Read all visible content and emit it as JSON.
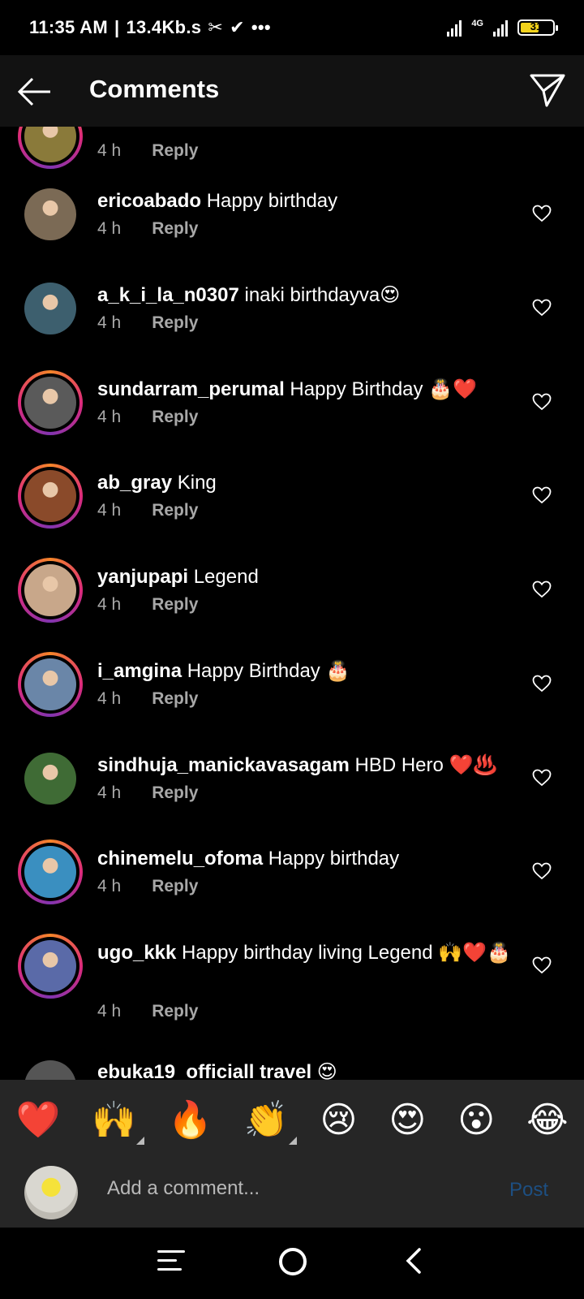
{
  "status_bar": {
    "time": "11:35 AM",
    "speed": "13.4Kb.s",
    "network": "4G",
    "battery": "31"
  },
  "header": {
    "title": "Comments"
  },
  "comments": [
    {
      "user": "",
      "text": "",
      "time": "4 h",
      "reply": "Reply",
      "ring": true,
      "avatar_color": "#8a7a3a"
    },
    {
      "user": "ericoabado",
      "text": " Happy birthday",
      "time": "4 h",
      "reply": "Reply",
      "ring": false,
      "avatar_color": "#7b6a55"
    },
    {
      "user": "a_k_i_la_n0307",
      "text": " inaki birthdayva😍",
      "time": "4 h",
      "reply": "Reply",
      "ring": false,
      "avatar_color": "#3d5f6e"
    },
    {
      "user": "sundarram_perumal",
      "text": " Happy Birthday 🎂❤️",
      "time": "4 h",
      "reply": "Reply",
      "ring": true,
      "avatar_color": "#5a5a5a"
    },
    {
      "user": "ab_gray",
      "text": " King",
      "time": "4 h",
      "reply": "Reply",
      "ring": true,
      "avatar_color": "#8a4a2a"
    },
    {
      "user": "yanjupapi",
      "text": " Legend",
      "time": "4 h",
      "reply": "Reply",
      "ring": true,
      "avatar_color": "#c8a78a"
    },
    {
      "user": "i_amgina",
      "text": " Happy Birthday 🎂",
      "time": "4 h",
      "reply": "Reply",
      "ring": true,
      "avatar_color": "#6a86a8"
    },
    {
      "user": "sindhuja_manickavasagam",
      "text": " HBD Hero ❤️♨️",
      "time": "4 h",
      "reply": "Reply",
      "ring": false,
      "avatar_color": "#3f6b35"
    },
    {
      "user": "chinemelu_ofoma",
      "text": " Happy birthday",
      "time": "4 h",
      "reply": "Reply",
      "ring": true,
      "avatar_color": "#3a8fc0"
    },
    {
      "user": "ugo_kkk",
      "text": " Happy birthday living Legend 🙌❤️🎂",
      "time": "4 h",
      "reply": "Reply",
      "ring": true,
      "avatar_color": "#5a6aa8"
    }
  ],
  "partial_comment": {
    "text": "ebuka19_officiall  travel 😍"
  },
  "emoji_bar": [
    "❤️",
    "🙌",
    "🔥",
    "👏",
    "😢",
    "😍",
    "😮",
    "😂"
  ],
  "composer": {
    "placeholder": "Add a comment...",
    "post_label": "Post"
  }
}
